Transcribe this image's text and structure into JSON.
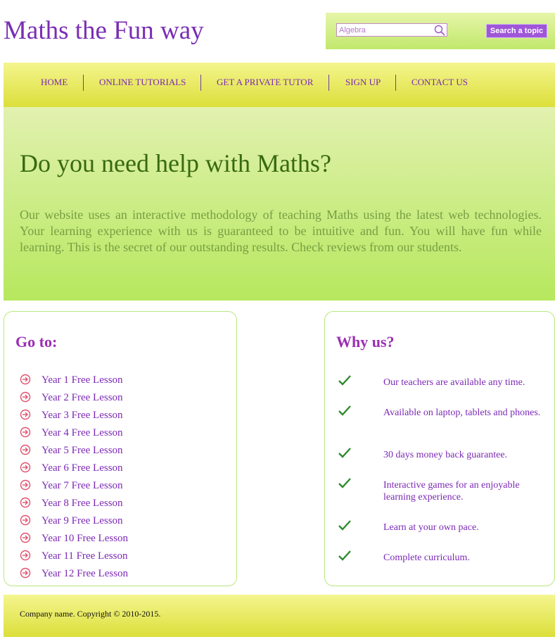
{
  "site": {
    "title": "Maths the Fun way"
  },
  "search": {
    "value": "Algebra",
    "button_label": "Search a topic",
    "icon": "search-icon"
  },
  "nav": {
    "items": [
      {
        "label": "HOME"
      },
      {
        "label": "ONLINE TUTORIALS"
      },
      {
        "label": "GET A PRIVATE TUTOR"
      },
      {
        "label": "SIGN UP"
      },
      {
        "label": "CONTACT US"
      }
    ]
  },
  "hero": {
    "heading": "Do you need help with Maths?",
    "text": "Our website uses an interactive methodology of teaching Maths using the latest web technologies. Your learning experience with us is guaranteed to be intuitive and fun. You will have fun while learning. This is the secret of our outstanding results. Check reviews from our students."
  },
  "goto": {
    "heading": "Go to:",
    "icon": "arrow-circle-icon",
    "items": [
      "Year 1 Free Lesson",
      "Year 2 Free Lesson",
      "Year 3 Free Lesson",
      "Year 4 Free Lesson",
      "Year 5 Free Lesson",
      "Year 6 Free Lesson",
      "Year 7 Free Lesson",
      "Year 8 Free Lesson",
      "Year 9 Free Lesson",
      "Year 10 Free Lesson",
      "Year 11 Free Lesson",
      "Year 12 Free Lesson"
    ]
  },
  "why": {
    "heading": "Why us?",
    "icon": "checkmark-icon",
    "items": [
      "Our teachers are available any time.",
      "Available on laptop, tablets and phones.",
      "30 days money back guarantee.",
      "Interactive games for an enjoyable learning experience.",
      "Learn at your own pace.",
      "Complete curriculum."
    ]
  },
  "footer": {
    "text": "Company name. Copyright © 2010-2015."
  },
  "colors": {
    "accent": "#7b28b5",
    "button": "#9f56d8",
    "heading_green": "#386a10",
    "lime": "#b6e85e",
    "yellow": "#dcdf3a",
    "check_green": "#2e8b2e",
    "arrow_red": "#e2506e"
  }
}
